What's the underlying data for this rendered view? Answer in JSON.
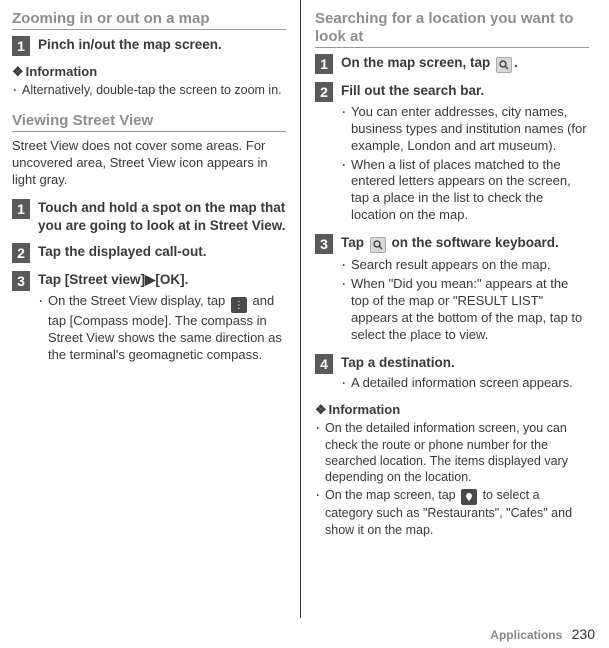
{
  "left": {
    "section1": {
      "title": "Zooming in or out on a map",
      "steps": [
        {
          "num": "1",
          "title": "Pinch in/out the map screen."
        }
      ],
      "info_head": "Information",
      "info_bullets": [
        "Alternatively, double-tap the screen to zoom in."
      ]
    },
    "section2": {
      "title": "Viewing Street View",
      "note": "Street View does not cover some areas. For uncovered area, Street View icon appears in light gray.",
      "steps": [
        {
          "num": "1",
          "title": "Touch and hold a spot on the map that you are going to look at in Street View."
        },
        {
          "num": "2",
          "title": "Tap the displayed call-out."
        },
        {
          "num": "3",
          "title": "Tap [Street view]▶[OK].",
          "bullets": [
            {
              "pre": "On the Street View display, tap ",
              "icon": "menu-icon",
              "post": " and tap [Compass mode]. The compass in Street View shows the same direction as the terminal's geomagnetic compass."
            }
          ]
        }
      ]
    }
  },
  "right": {
    "section1": {
      "title": "Searching for a location you want to look at",
      "steps": [
        {
          "num": "1",
          "title_pre": "On the map screen, tap ",
          "title_icon": "search-icon",
          "title_post": "."
        },
        {
          "num": "2",
          "title": "Fill out the search bar.",
          "bullets": [
            {
              "text": "You can enter addresses, city names, business types and institution names (for example, London and art museum)."
            },
            {
              "text": "When a list of places matched to the entered letters appears on the screen, tap a place in the list to check the location on the map."
            }
          ]
        },
        {
          "num": "3",
          "title_pre": "Tap ",
          "title_icon": "search-go-icon",
          "title_post": " on the software keyboard.",
          "bullets": [
            {
              "text": "Search result appears on the map."
            },
            {
              "text": "When \"Did you mean:\" appears at the top of the map or \"RESULT LIST\" appears at the bottom of the map, tap to select the place to view."
            }
          ]
        },
        {
          "num": "4",
          "title": "Tap a destination.",
          "bullets": [
            {
              "text": "A detailed information screen appears."
            }
          ]
        }
      ],
      "info_head": "Information",
      "info_bullets": [
        {
          "text": "On the detailed information screen, you can check the route or phone number for the searched location. The items displayed vary depending on the location."
        },
        {
          "pre": "On the map screen, tap ",
          "icon": "places-icon",
          "post": " to select a category such as \"Restaurants\", \"Cafes\" and show it on the map."
        }
      ]
    }
  },
  "footer": {
    "label": "Applications",
    "page": "230"
  }
}
